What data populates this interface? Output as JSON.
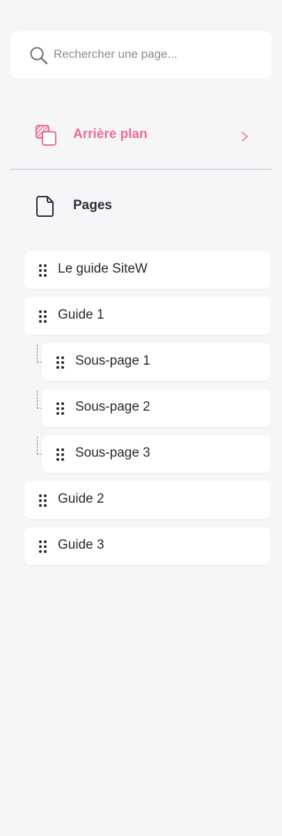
{
  "search": {
    "placeholder": "Rechercher une page..."
  },
  "background_row": {
    "label": "Arrière plan",
    "accent": "#ee6c8e"
  },
  "pages_section": {
    "label": "Pages"
  },
  "pages": [
    {
      "title": "Le guide SiteW",
      "level": 0
    },
    {
      "title": "Guide 1",
      "level": 0
    },
    {
      "title": "Sous-page 1",
      "level": 1
    },
    {
      "title": "Sous-page 2",
      "level": 1
    },
    {
      "title": "Sous-page 3",
      "level": 1
    },
    {
      "title": "Guide 2",
      "level": 0
    },
    {
      "title": "Guide 3",
      "level": 0
    }
  ],
  "icons": [
    "search-icon",
    "background-layers-icon",
    "chevron-right-icon",
    "page-document-icon",
    "drag-handle-icon"
  ]
}
